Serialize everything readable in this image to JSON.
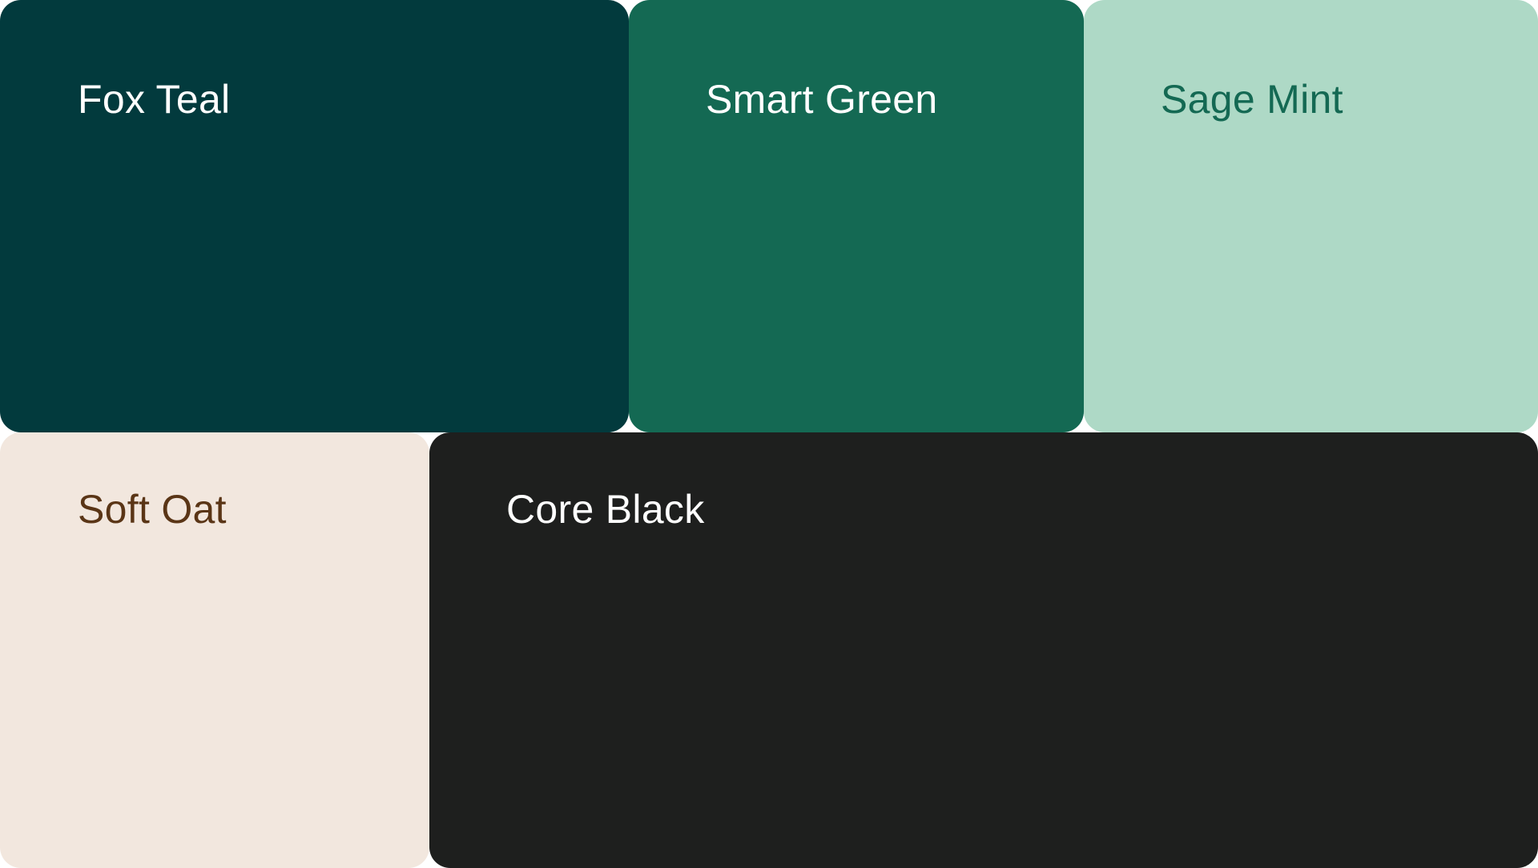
{
  "swatches": [
    {
      "name": "Fox Teal",
      "background": "#023a3d",
      "text_color": "#ffffff"
    },
    {
      "name": "Smart Green",
      "background": "#146953",
      "text_color": "#ffffff"
    },
    {
      "name": "Sage Mint",
      "background": "#aed9c6",
      "text_color": "#146953"
    },
    {
      "name": "Soft Oat",
      "background": "#f2e7de",
      "text_color": "#5a3516"
    },
    {
      "name": "Core Black",
      "background": "#1e1f1e",
      "text_color": "#ffffff"
    }
  ]
}
